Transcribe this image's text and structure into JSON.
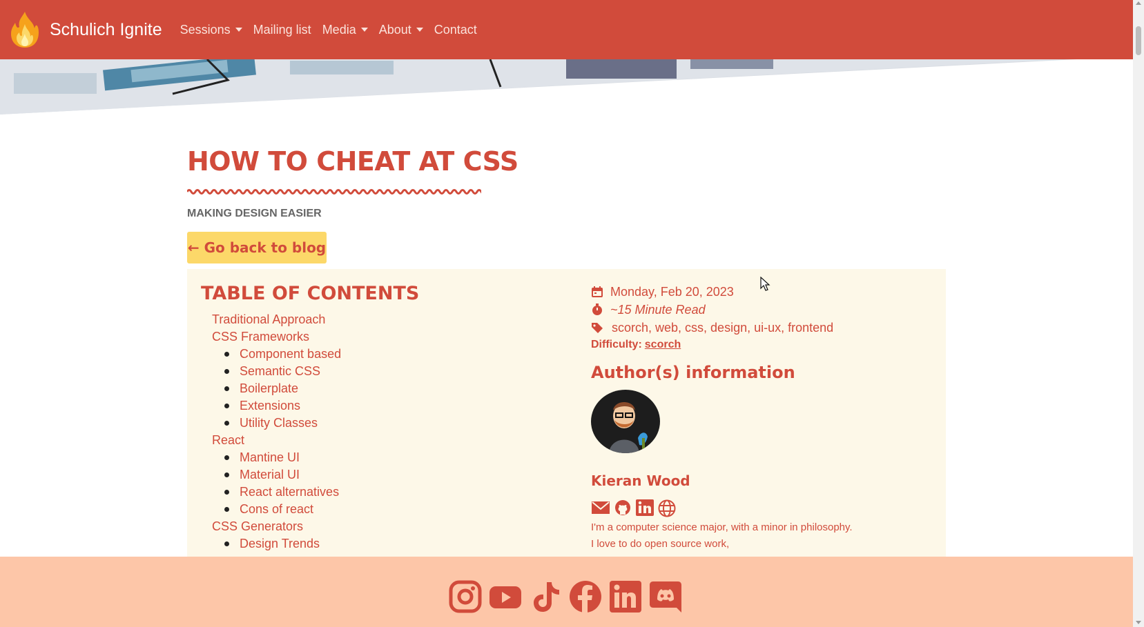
{
  "navbar": {
    "brand": "Schulich Ignite",
    "items": [
      {
        "label": "Sessions",
        "dropdown": true
      },
      {
        "label": "Mailing list",
        "dropdown": false
      },
      {
        "label": "Media",
        "dropdown": true
      },
      {
        "label": "About",
        "dropdown": true
      },
      {
        "label": "Contact",
        "dropdown": false
      }
    ]
  },
  "post": {
    "title": "HOW TO CHEAT AT CSS",
    "subtitle": "MAKING DESIGN EASIER",
    "back_label": "← Go back to blog"
  },
  "toc": {
    "heading": "TABLE OF CONTENTS",
    "items": [
      {
        "label": "Traditional Approach",
        "level": 0
      },
      {
        "label": "CSS Frameworks",
        "level": 0
      },
      {
        "label": "Component based",
        "level": 1
      },
      {
        "label": "Semantic CSS",
        "level": 1
      },
      {
        "label": "Boilerplate",
        "level": 1
      },
      {
        "label": "Extensions",
        "level": 1
      },
      {
        "label": "Utility Classes",
        "level": 1
      },
      {
        "label": "React",
        "level": 0
      },
      {
        "label": "Mantine UI",
        "level": 1
      },
      {
        "label": "Material UI",
        "level": 1
      },
      {
        "label": "React alternatives",
        "level": 1
      },
      {
        "label": "Cons of react",
        "level": 1
      },
      {
        "label": "CSS Generators",
        "level": 0
      },
      {
        "label": "Design Trends",
        "level": 1
      }
    ]
  },
  "meta": {
    "date": "Monday, Feb 20, 2023",
    "read_time": "~15 Minute Read",
    "tags": "scorch, web, css, design, ui-ux, frontend",
    "difficulty_label": "Difficulty:",
    "difficulty_value": "scorch"
  },
  "author": {
    "heading": "Author(s) information",
    "name": "Kieran Wood",
    "bio": "I'm a computer science major, with a minor in philosophy. I love to do open source work,",
    "links": [
      "email-icon",
      "github-icon",
      "linkedin-icon",
      "globe-icon"
    ]
  },
  "footer": {
    "social": [
      "instagram-icon",
      "youtube-icon",
      "tiktok-icon",
      "facebook-icon",
      "linkedin-icon",
      "discord-icon"
    ]
  },
  "colors": {
    "brand": "#d14b3b",
    "button": "#fcd869",
    "panel": "#fdf8e8",
    "footer": "#fdc6a8"
  }
}
